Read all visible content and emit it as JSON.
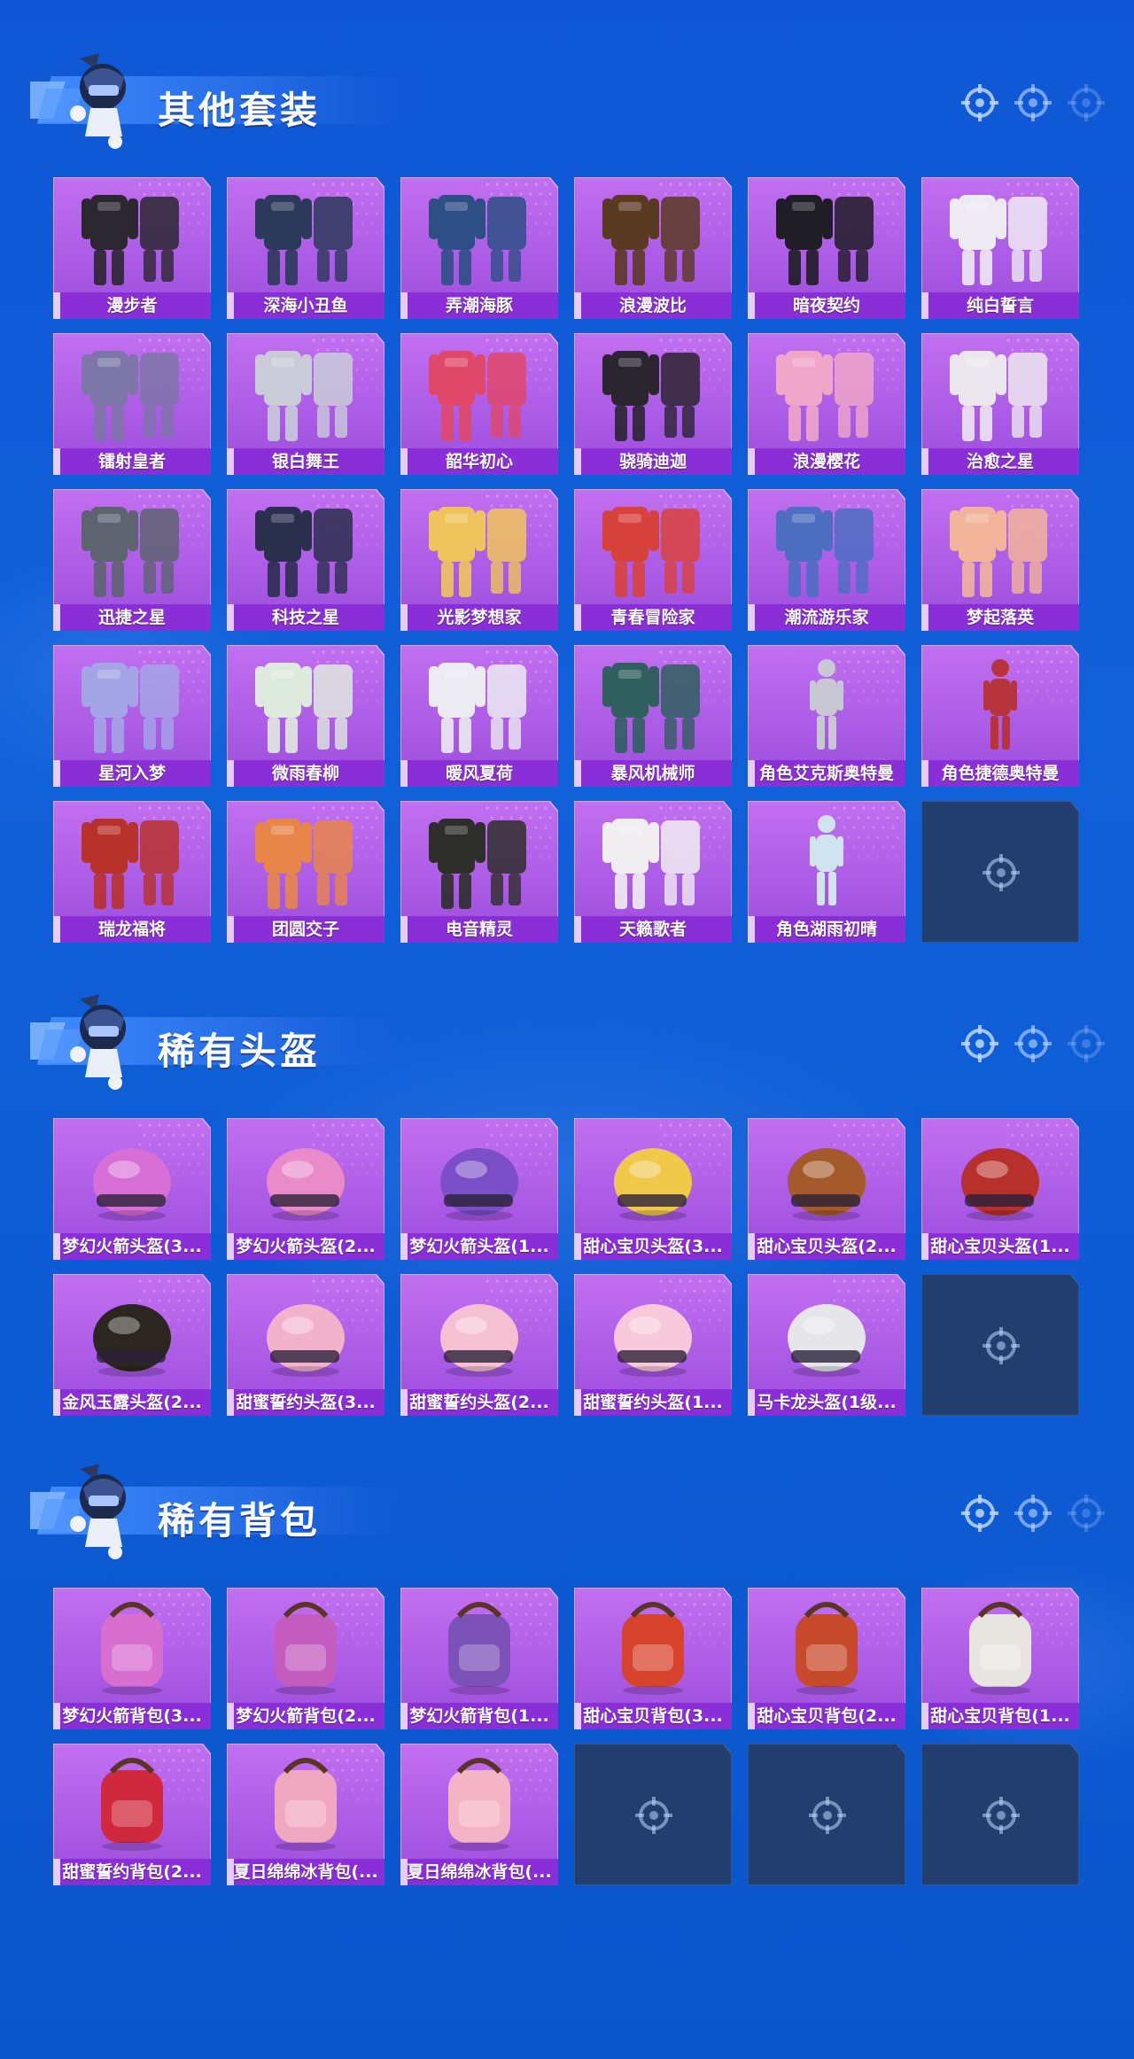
{
  "colors": {
    "page_bg": "#0f58d6",
    "card_purple": "#b561e8",
    "card_purple_dark": "#8d3fd0",
    "label_bar": "#8a2fd8",
    "card_border": "#d7a8ff",
    "empty_slot": "#213e6e",
    "title_text": "#ffffff"
  },
  "sections": [
    {
      "title": "其他套装",
      "mascot_icon": "mascot-character-icon",
      "items": [
        {
          "label": "漫步者",
          "icon": "dark-outfit-icon",
          "tone": "#2a2730"
        },
        {
          "label": "深海小丑鱼",
          "icon": "diver-outfit-icon",
          "tone": "#2b3a5a"
        },
        {
          "label": "弄潮海豚",
          "icon": "street-outfit-icon",
          "tone": "#2d4f86"
        },
        {
          "label": "浪漫波比",
          "icon": "brown-outfit-icon",
          "tone": "#5b3a22"
        },
        {
          "label": "暗夜契约",
          "icon": "black-dress-icon",
          "tone": "#1f1d26"
        },
        {
          "label": "纯白誓言",
          "icon": "white-dress-icon",
          "tone": "#eeeaf4"
        },
        {
          "label": "镭射皇者",
          "icon": "laser-outfit-icon",
          "tone": "#7d76a8"
        },
        {
          "label": "银白舞王",
          "icon": "silver-outfit-icon",
          "tone": "#c9ccd8"
        },
        {
          "label": "韶华初心",
          "icon": "red-dress-icon",
          "tone": "#e0486a"
        },
        {
          "label": "骁骑迪迦",
          "icon": "hero-suit-icon",
          "tone": "#2b2530"
        },
        {
          "label": "浪漫樱花",
          "icon": "pink-dress-icon",
          "tone": "#f0a6c8"
        },
        {
          "label": "治愈之星",
          "icon": "nurse-outfit-icon",
          "tone": "#ece7ef"
        },
        {
          "label": "迅捷之星",
          "icon": "grey-outfit-icon",
          "tone": "#5d6470"
        },
        {
          "label": "科技之星",
          "icon": "tech-outfit-icon",
          "tone": "#2a2f4e"
        },
        {
          "label": "光影梦想家",
          "icon": "yellow-mech-icon",
          "tone": "#f0c45c"
        },
        {
          "label": "青春冒险家",
          "icon": "red-jacket-icon",
          "tone": "#d8423c"
        },
        {
          "label": "潮流游乐家",
          "icon": "blue-coat-icon",
          "tone": "#4c6fc2"
        },
        {
          "label": "梦起落英",
          "icon": "peach-dress-icon",
          "tone": "#f2b49a"
        },
        {
          "label": "星河入梦",
          "icon": "lavender-dress-icon",
          "tone": "#a4a5e6"
        },
        {
          "label": "微雨春柳",
          "icon": "pale-green-coat-icon",
          "tone": "#dfeadf"
        },
        {
          "label": "暖风夏荷",
          "icon": "white-coat-icon",
          "tone": "#ecebf2"
        },
        {
          "label": "暴风机械师",
          "icon": "mech-suit-icon",
          "tone": "#2f5f5e"
        },
        {
          "label": "角色艾克斯奥特曼",
          "icon": "hero-figure-icon",
          "tone": "#c8c8d4"
        },
        {
          "label": "角色捷德奥特曼",
          "icon": "red-hero-figure-icon",
          "tone": "#b8343c"
        },
        {
          "label": "瑞龙福将",
          "icon": "dragon-outfit-icon",
          "tone": "#b8322c"
        },
        {
          "label": "团圆交子",
          "icon": "festival-outfit-icon",
          "tone": "#e8864a"
        },
        {
          "label": "电音精灵",
          "icon": "black-jacket-icon",
          "tone": "#2e2f2b"
        },
        {
          "label": "天籁歌者",
          "icon": "white-suit-icon",
          "tone": "#f1eef2"
        },
        {
          "label": "角色湖雨初晴",
          "icon": "girl-figure-icon",
          "tone": "#cfe4ee"
        },
        {
          "empty": true
        }
      ]
    },
    {
      "title": "稀有头盔",
      "mascot_icon": "mascot-character-icon",
      "items": [
        {
          "label": "梦幻火箭头盔(3...",
          "icon": "rocket-helmet-icon",
          "tone": "#d76fd6"
        },
        {
          "label": "梦幻火箭头盔(2...",
          "icon": "rocket-helmet-icon",
          "tone": "#e98bc8"
        },
        {
          "label": "梦幻火箭头盔(1...",
          "icon": "rocket-helmet-icon",
          "tone": "#7a4fc8"
        },
        {
          "label": "甜心宝贝头盔(3...",
          "icon": "cupcake-helmet-icon",
          "tone": "#f0c84a"
        },
        {
          "label": "甜心宝贝头盔(2...",
          "icon": "cupcake-helmet-icon",
          "tone": "#a45a2a"
        },
        {
          "label": "甜心宝贝头盔(1...",
          "icon": "cupcake-helmet-icon",
          "tone": "#b8302c"
        },
        {
          "label": "金风玉露头盔(2...",
          "icon": "gold-helmet-icon",
          "tone": "#2c2620"
        },
        {
          "label": "甜蜜誓约头盔(3...",
          "icon": "pink-helmet-icon",
          "tone": "#f2b2cc"
        },
        {
          "label": "甜蜜誓约头盔(2...",
          "icon": "pink-helmet-icon",
          "tone": "#f5c0d2"
        },
        {
          "label": "甜蜜誓约头盔(1...",
          "icon": "pink-helmet-icon",
          "tone": "#f7c9da"
        },
        {
          "label": "马卡龙头盔(1级...",
          "icon": "white-helmet-icon",
          "tone": "#e6e6ea"
        },
        {
          "empty": true
        }
      ]
    },
    {
      "title": "稀有背包",
      "mascot_icon": "mascot-character-icon",
      "items": [
        {
          "label": "梦幻火箭背包(3...",
          "icon": "rocket-backpack-icon",
          "tone": "#d86ed0"
        },
        {
          "label": "梦幻火箭背包(2...",
          "icon": "rocket-backpack-icon",
          "tone": "#c45bbf"
        },
        {
          "label": "梦幻火箭背包(1...",
          "icon": "rocket-backpack-icon",
          "tone": "#7c52b8"
        },
        {
          "label": "甜心宝贝背包(3...",
          "icon": "cake-backpack-icon",
          "tone": "#d8432e"
        },
        {
          "label": "甜心宝贝背包(2...",
          "icon": "cake-backpack-icon",
          "tone": "#c84a2c"
        },
        {
          "label": "甜心宝贝背包(1...",
          "icon": "cake-backpack-icon",
          "tone": "#e8e4e0"
        },
        {
          "label": "甜蜜誓约背包(2...",
          "icon": "bow-backpack-icon",
          "tone": "#d0283c"
        },
        {
          "label": "夏日绵绵冰背包(...",
          "icon": "icecream-backpack-icon",
          "tone": "#f0a8c0"
        },
        {
          "label": "夏日绵绵冰背包(...",
          "icon": "icecream-backpack-icon",
          "tone": "#f4b4c6"
        },
        {
          "empty": true
        },
        {
          "empty": true
        },
        {
          "empty": true
        }
      ]
    }
  ]
}
